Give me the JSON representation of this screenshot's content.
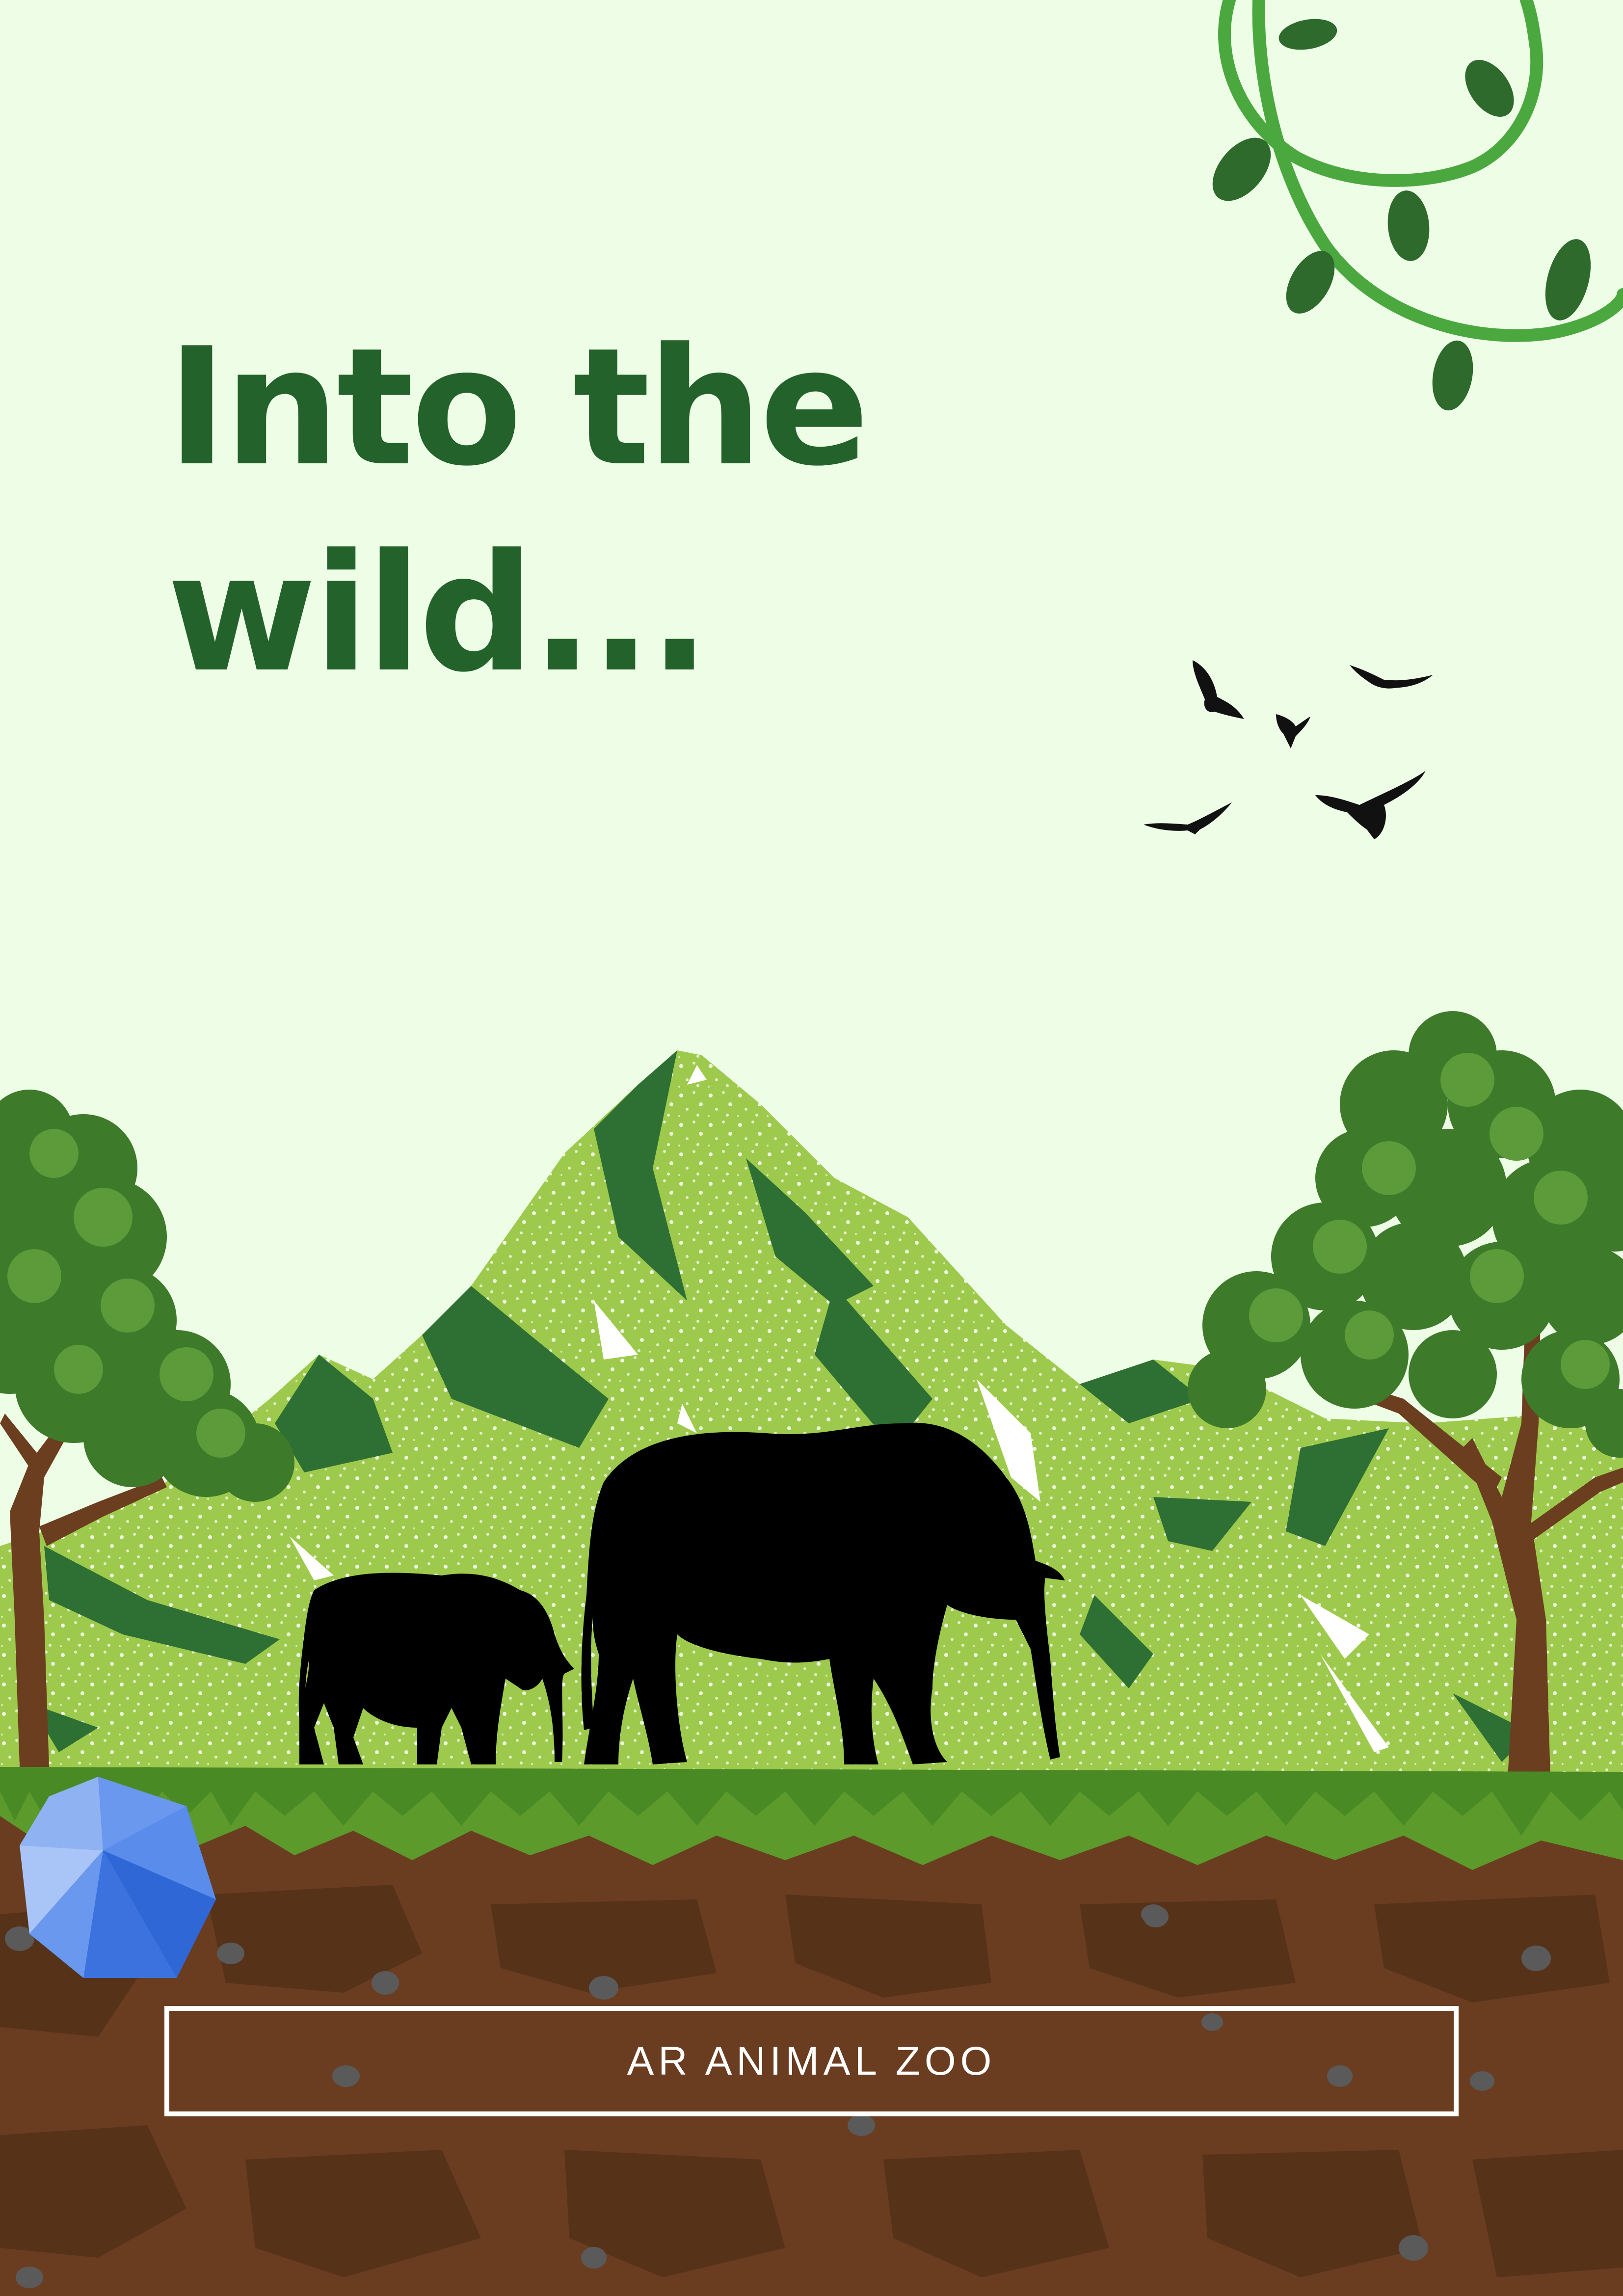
{
  "poster": {
    "headline_line1": "Into the",
    "headline_line2": "wild...",
    "banner_label": "AR ANIMAL ZOO"
  },
  "colors": {
    "background": "#eefde6",
    "headline": "#23632b",
    "mountain_light": "#9dca4c",
    "mountain_dark": "#2e6f33",
    "grass": "#5c9a2c",
    "soil": "#6a3d20",
    "soil_dark": "#4f2d17",
    "vine": "#4aa83f",
    "leaf": "#2d6a2c",
    "tree_trunk": "#6b3e1f",
    "tree_canopy": "#3d7a2a",
    "silhouette": "#000000",
    "gem": "#3e7be6",
    "banner_border": "#ffffff"
  },
  "illustration": {
    "subjects": [
      "adult-elephant-icon",
      "baby-elephant-icon",
      "flying-bird-icon",
      "mountain-icon",
      "tree-icon",
      "vine-icon",
      "gem-icon",
      "soil-icon"
    ]
  }
}
